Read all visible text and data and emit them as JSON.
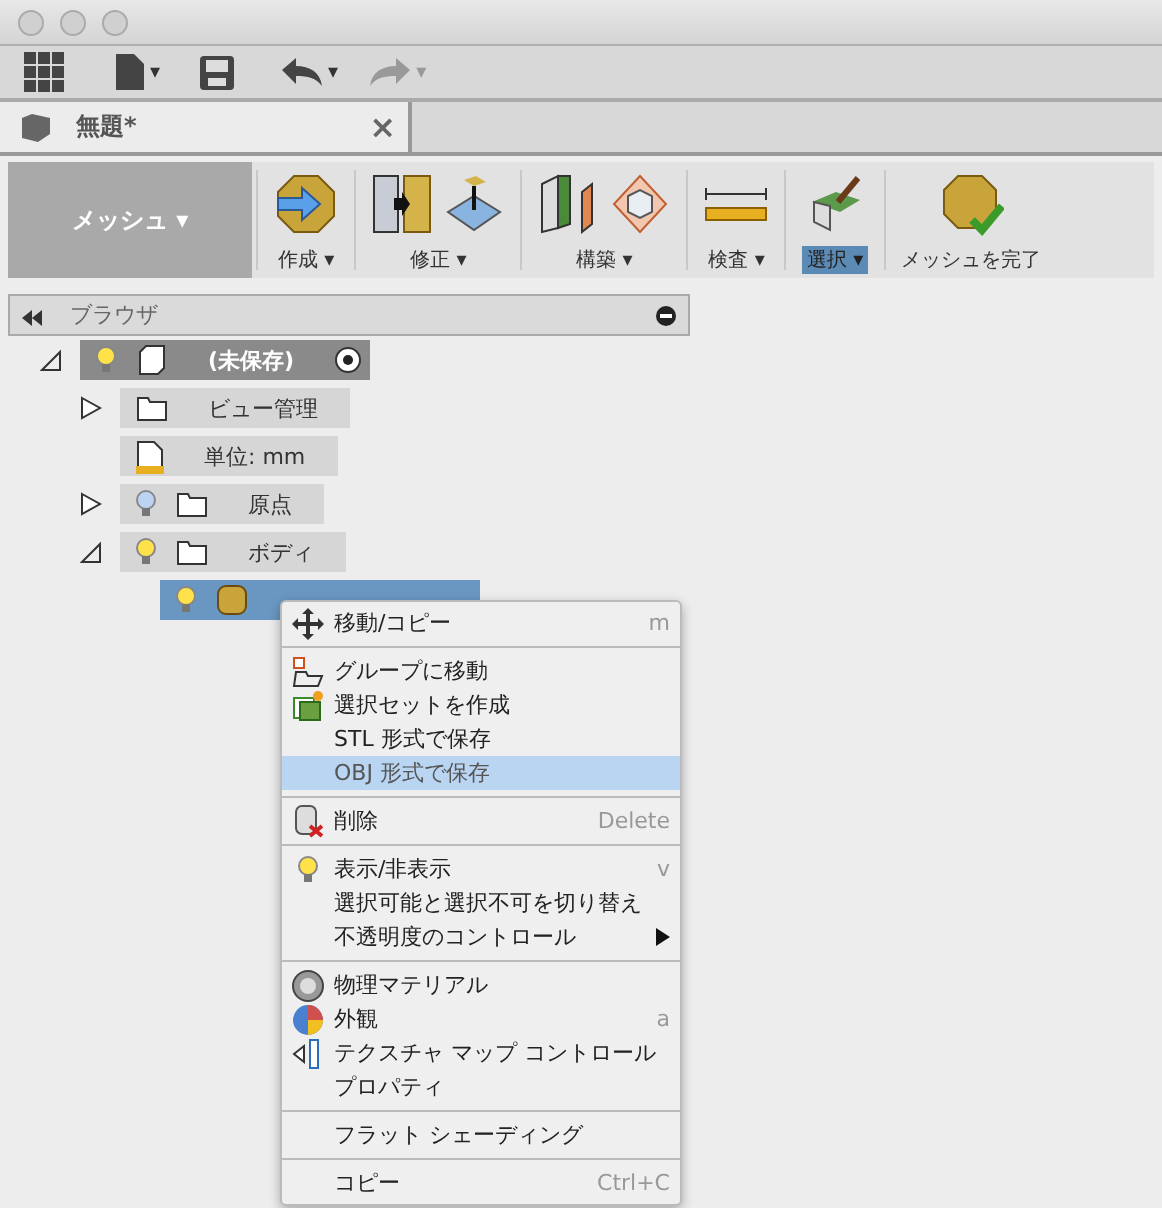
{
  "toolbar": {
    "undo_caret": "▾",
    "redo_caret": "▾",
    "file_caret": "▾"
  },
  "tab": {
    "title": "無題*",
    "close": "×"
  },
  "ribbon": {
    "workspace": "メッシュ ▾",
    "groups": [
      {
        "label": "作成 ▾",
        "selected": false
      },
      {
        "label": "修正 ▾",
        "selected": false
      },
      {
        "label": "構築 ▾",
        "selected": false
      },
      {
        "label": "検査 ▾",
        "selected": false
      },
      {
        "label": "選択 ▾",
        "selected": true
      },
      {
        "label": "メッシュを完了",
        "selected": false
      }
    ]
  },
  "browser": {
    "title": "ブラウザ",
    "tree": [
      {
        "label": "(未保存)",
        "expanded": true,
        "lit": true,
        "selected": true,
        "children": [
          {
            "label": "ビュー管理",
            "expanded": false,
            "selected": false
          },
          {
            "label": "単位: mm",
            "selected": false
          },
          {
            "label": "原点",
            "expanded": false,
            "lit": false,
            "selected": false
          },
          {
            "label": "ボディ",
            "expanded": true,
            "lit": true,
            "selected": false,
            "children": [
              {
                "lit": true,
                "selected": true
              }
            ]
          }
        ]
      }
    ]
  },
  "context_menu": [
    {
      "kind": "item",
      "label": "移動/コピー",
      "shortcut": "m",
      "selected": false
    },
    {
      "kind": "separator"
    },
    {
      "kind": "item",
      "label": "グループに移動",
      "selected": false
    },
    {
      "kind": "item",
      "label": "選択セットを作成",
      "selected": false
    },
    {
      "kind": "item",
      "label": "STL 形式で保存",
      "selected": false
    },
    {
      "kind": "item",
      "label": "OBJ 形式で保存",
      "selected": true
    },
    {
      "kind": "separator"
    },
    {
      "kind": "item",
      "label": "削除",
      "shortcut": "Delete",
      "selected": false
    },
    {
      "kind": "separator"
    },
    {
      "kind": "item",
      "label": "表示/非表示",
      "shortcut": "v",
      "selected": false
    },
    {
      "kind": "item",
      "label": "選択可能と選択不可を切り替え",
      "selected": false
    },
    {
      "kind": "item",
      "label": "不透明度のコントロール",
      "submenu": true,
      "selected": false
    },
    {
      "kind": "separator"
    },
    {
      "kind": "item",
      "label": "物理マテリアル",
      "selected": false
    },
    {
      "kind": "item",
      "label": "外観",
      "shortcut": "a",
      "selected": false
    },
    {
      "kind": "item",
      "label": "テクスチャ マップ コントロール",
      "selected": false
    },
    {
      "kind": "item",
      "label": "プロパティ",
      "selected": false
    },
    {
      "kind": "separator"
    },
    {
      "kind": "item",
      "label": "フラット シェーディング",
      "selected": false
    },
    {
      "kind": "separator"
    },
    {
      "kind": "item",
      "label": "コピー",
      "shortcut": "Ctrl+C",
      "selected": false
    }
  ]
}
